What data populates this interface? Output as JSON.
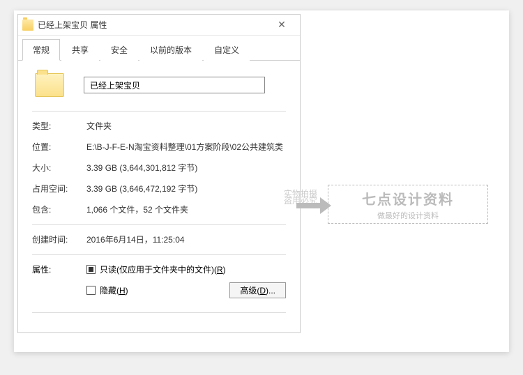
{
  "titlebar": {
    "title": "已经上架宝贝 属性"
  },
  "tabs": [
    "常规",
    "共享",
    "安全",
    "以前的版本",
    "自定义"
  ],
  "folder_name": "已经上架宝贝",
  "labels": {
    "type": "类型:",
    "location": "位置:",
    "size": "大小:",
    "size_on_disk": "占用空间:",
    "contains": "包含:",
    "created": "创建时间:",
    "attributes": "属性:"
  },
  "values": {
    "type": "文件夹",
    "location": "E:\\B-J-F-E-N淘宝资料整理\\01方案阶段\\02公共建筑类",
    "size": "3.39 GB (3,644,301,812 字节)",
    "size_on_disk": "3.39 GB (3,646,472,192 字节)",
    "contains": "1,066 个文件，52 个文件夹",
    "created": "2016年6月14日，11:25:04"
  },
  "readonly_prefix": "只读(仅应用于文件夹中的文件)(",
  "readonly_key": "R",
  "readonly_suffix": ")",
  "hidden_prefix": "隐藏(",
  "hidden_key": "H",
  "hidden_suffix": ")",
  "advanced_label": "高级(",
  "advanced_key": "D",
  "advanced_suffix": ")...",
  "watermark": {
    "title": "七点设计资料",
    "subtitle": "做最好的设计资料",
    "stamp1": "实物拍摄",
    "stamp2": "盗用必究"
  }
}
